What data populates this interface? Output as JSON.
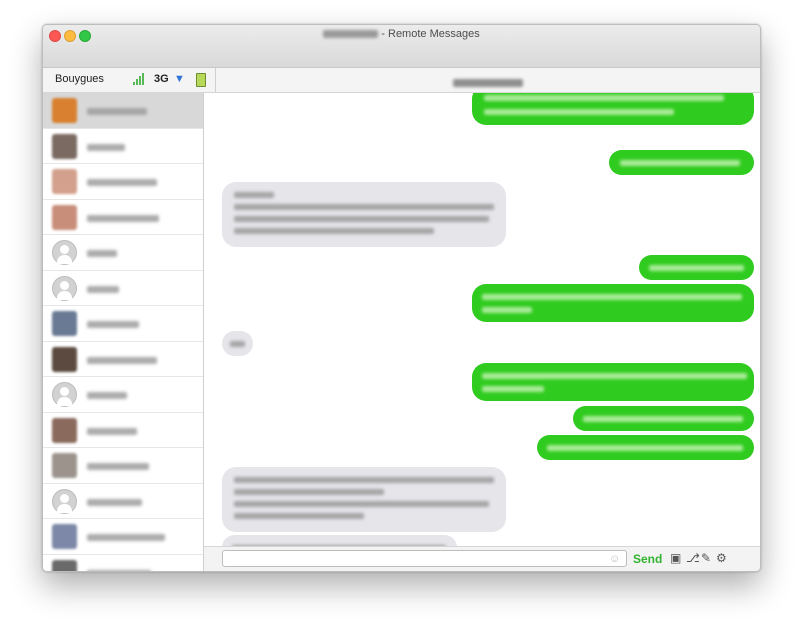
{
  "window": {
    "title_suffix": "- Remote Messages"
  },
  "header": {
    "carrier": "Bouygues",
    "network_type": "3G"
  },
  "composer": {
    "send_label": "Send",
    "input_value": ""
  },
  "contacts": [
    {
      "avatar": "#d8802f",
      "name_width": 60,
      "selected": true
    },
    {
      "avatar": "#7a6a62",
      "name_width": 38
    },
    {
      "avatar": "#d2a08c",
      "name_width": 70
    },
    {
      "avatar": "#c98e7a",
      "name_width": 72
    },
    {
      "avatar": "placeholder",
      "name_width": 30
    },
    {
      "avatar": "placeholder",
      "name_width": 32
    },
    {
      "avatar": "#6a7a94",
      "name_width": 52
    },
    {
      "avatar": "#5c4a40",
      "name_width": 70
    },
    {
      "avatar": "placeholder",
      "name_width": 40
    },
    {
      "avatar": "#8a6a5c",
      "name_width": 50
    },
    {
      "avatar": "#9c948c",
      "name_width": 62
    },
    {
      "avatar": "placeholder",
      "name_width": 55
    },
    {
      "avatar": "#7d88a8",
      "name_width": 78
    },
    {
      "avatar": "#6a6a6a",
      "name_width": 64
    }
  ]
}
